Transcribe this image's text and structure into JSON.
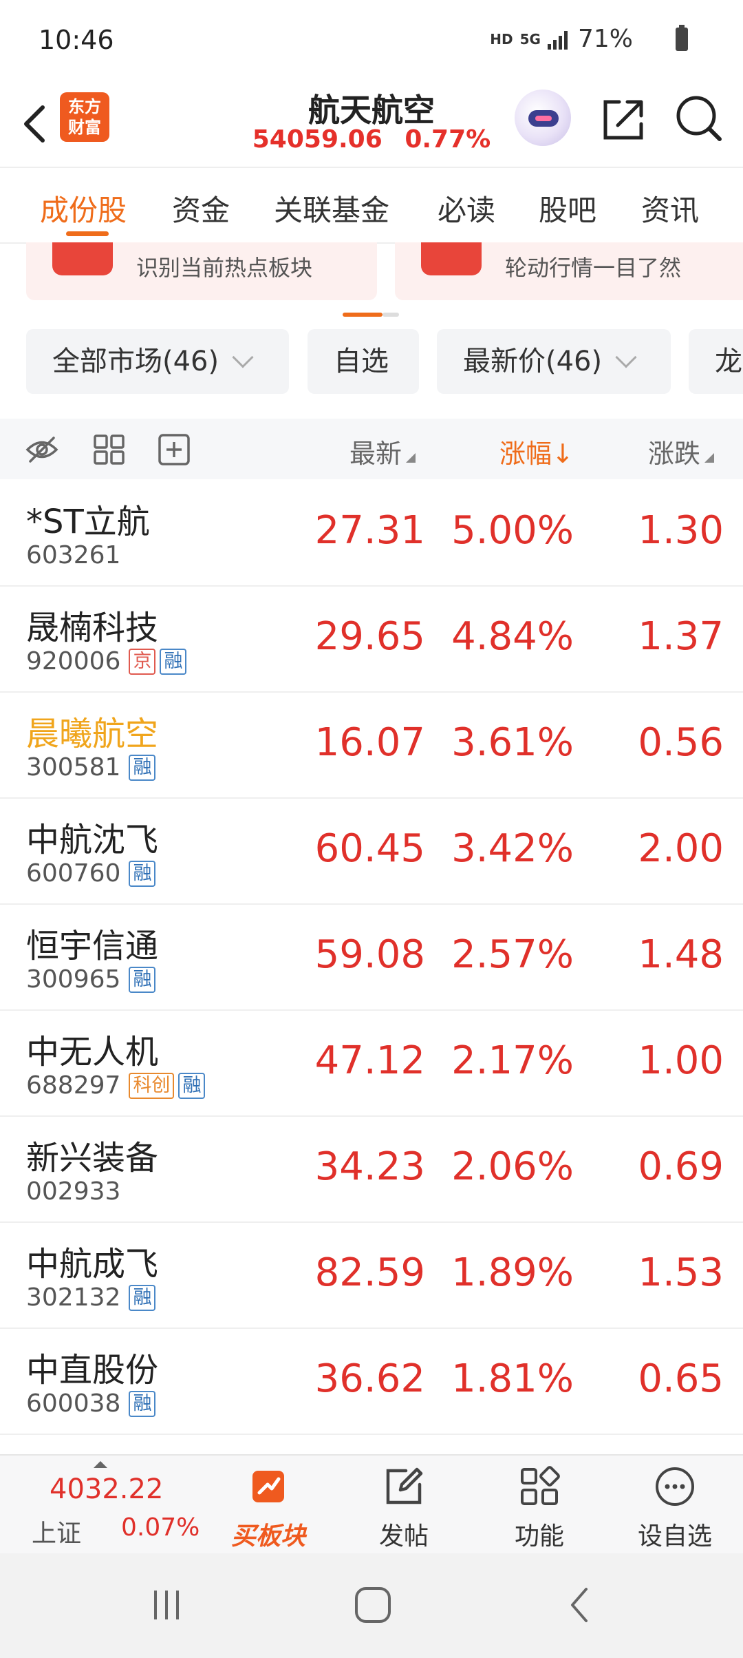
{
  "status_bar": {
    "time": "10:46",
    "hd": "HD",
    "network": "5G",
    "battery": "71%"
  },
  "header": {
    "logo_text_top": "东方",
    "logo_text_bottom": "财富",
    "title": "航天航空",
    "index_value": "54059.06",
    "index_change": "0.77%"
  },
  "tabs": [
    {
      "label": "成份股",
      "active": true
    },
    {
      "label": "资金"
    },
    {
      "label": "关联基金"
    },
    {
      "label": "必读"
    },
    {
      "label": "股吧"
    },
    {
      "label": "资讯"
    }
  ],
  "promos": [
    {
      "text": "识别当前热点板块"
    },
    {
      "text": "轮动行情一目了然"
    }
  ],
  "filters": [
    {
      "label": "全部市场(46)"
    },
    {
      "label": "自选"
    },
    {
      "label": "最新价(46)"
    },
    {
      "label": "龙"
    }
  ],
  "list_header": {
    "col_latest": "最新",
    "col_pct": "涨幅↓",
    "col_change": "涨跌"
  },
  "stocks": [
    {
      "name": "*ST立航",
      "code": "603261",
      "price": "27.31",
      "pct": "5.00%",
      "change": "1.30",
      "badges": []
    },
    {
      "name": "晟楠科技",
      "code": "920006",
      "price": "29.65",
      "pct": "4.84%",
      "change": "1.37",
      "badges": [
        "京",
        "融"
      ]
    },
    {
      "name": "晨曦航空",
      "code": "300581",
      "price": "16.07",
      "pct": "3.61%",
      "change": "0.56",
      "badges": [
        "融"
      ],
      "highlight": true
    },
    {
      "name": "中航沈飞",
      "code": "600760",
      "price": "60.45",
      "pct": "3.42%",
      "change": "2.00",
      "badges": [
        "融"
      ]
    },
    {
      "name": "恒宇信通",
      "code": "300965",
      "price": "59.08",
      "pct": "2.57%",
      "change": "1.48",
      "badges": [
        "融"
      ]
    },
    {
      "name": "中无人机",
      "code": "688297",
      "price": "47.12",
      "pct": "2.17%",
      "change": "1.00",
      "badges": [
        "科创",
        "融"
      ]
    },
    {
      "name": "新兴装备",
      "code": "002933",
      "price": "34.23",
      "pct": "2.06%",
      "change": "0.69",
      "badges": []
    },
    {
      "name": "中航成飞",
      "code": "302132",
      "price": "82.59",
      "pct": "1.89%",
      "change": "1.53",
      "badges": [
        "融"
      ]
    },
    {
      "name": "中直股份",
      "code": "600038",
      "price": "36.62",
      "pct": "1.81%",
      "change": "0.65",
      "badges": [
        "融"
      ]
    }
  ],
  "bottom_bar": {
    "index_value": "4032.22",
    "index_name": "上证",
    "index_change": "0.07%",
    "buy_sector": "买板块",
    "post": "发帖",
    "functions": "功能",
    "set_watchlist": "设自选"
  },
  "colors": {
    "accent": "#ef6c1a",
    "up_red": "#e0302a",
    "highlight_gold": "#f0a51c"
  }
}
